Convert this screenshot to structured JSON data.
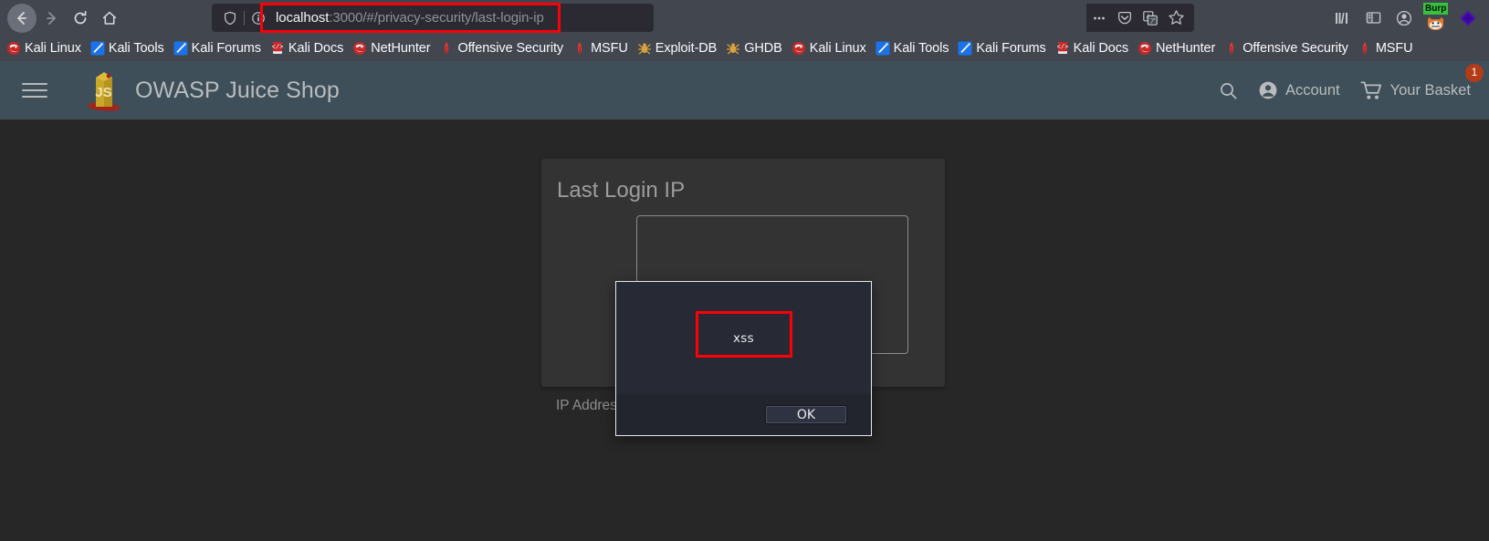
{
  "browser": {
    "nav": {
      "back_icon": "arrow-left-icon",
      "forward_icon": "arrow-right-icon",
      "reload_icon": "reload-icon",
      "home_icon": "home-icon"
    },
    "urlbar": {
      "shield_icon": "shield-icon",
      "info_icon": "info-circle-icon",
      "host": "localhost",
      "path": ":3000/#/privacy-security/last-login-ip",
      "full_url": "localhost:3000/#/privacy-security/last-login-ip",
      "annotation_color": "#fb0007",
      "actions": [
        {
          "name": "page-actions-icon",
          "glyph": "…"
        },
        {
          "name": "pocket-icon",
          "glyph": ""
        },
        {
          "name": "translate-icon",
          "glyph": ""
        },
        {
          "name": "bookmark-star-icon",
          "glyph": "☆"
        }
      ]
    },
    "toolbar_right": [
      {
        "name": "library-icon"
      },
      {
        "name": "sidebar-icon"
      },
      {
        "name": "account-icon"
      },
      {
        "name": "burp-suite-extension-icon",
        "badge": "Burp",
        "badge_color": "#35c23c"
      },
      {
        "name": "wappalyzer-extension-icon",
        "color": "#4b0bbd"
      }
    ],
    "bookmarks": [
      {
        "label": "Kali Linux",
        "icon": "kali-dragon-icon"
      },
      {
        "label": "Kali Tools",
        "icon": "kali-tools-icon"
      },
      {
        "label": "Kali Forums",
        "icon": "kali-forums-icon"
      },
      {
        "label": "Kali Docs",
        "icon": "kali-docs-icon"
      },
      {
        "label": "NetHunter",
        "icon": "nethunter-icon"
      },
      {
        "label": "Offensive Security",
        "icon": "offsec-icon"
      },
      {
        "label": "MSFU",
        "icon": "msfu-icon"
      },
      {
        "label": "Exploit-DB",
        "icon": "exploit-db-icon"
      },
      {
        "label": "GHDB",
        "icon": "ghdb-icon"
      },
      {
        "label": "Kali Linux",
        "icon": "kali-dragon-icon"
      },
      {
        "label": "Kali Tools",
        "icon": "kali-tools-icon"
      },
      {
        "label": "Kali Forums",
        "icon": "kali-forums-icon"
      },
      {
        "label": "Kali Docs",
        "icon": "kali-docs-icon"
      },
      {
        "label": "NetHunter",
        "icon": "nethunter-icon"
      },
      {
        "label": "Offensive Security",
        "icon": "offsec-icon"
      },
      {
        "label": "MSFU",
        "icon": "msfu-icon"
      }
    ]
  },
  "app": {
    "header": {
      "menu_icon": "hamburger-menu-icon",
      "logo_icon": "juice-shop-logo-icon",
      "title": "OWASP Juice Shop",
      "search_icon": "search-icon",
      "account_icon": "account-person-icon",
      "account_label": "Account",
      "basket_icon": "shopping-cart-icon",
      "basket_label": "Your Basket",
      "basket_count": "1",
      "basket_badge_color": "#b23c17"
    },
    "card": {
      "title": "Last Login IP",
      "ip_address_label": "IP Address"
    }
  },
  "dialog": {
    "message": "xss",
    "ok_label": "OK",
    "annotation_color": "#fb0007"
  }
}
